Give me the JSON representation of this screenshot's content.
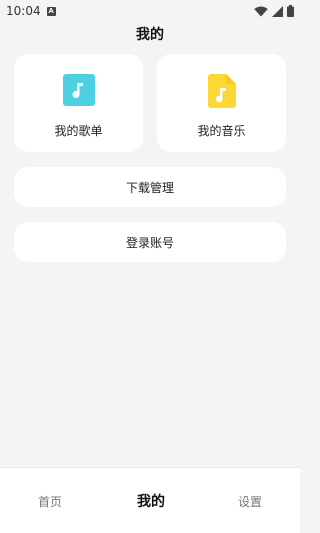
{
  "status_bar": {
    "time": "10:04",
    "notification_icon": "a-icon",
    "wifi_icon": "wifi-icon",
    "signal_icon": "signal-icon",
    "battery_icon": "battery-icon"
  },
  "header": {
    "title": "我的"
  },
  "cards": [
    {
      "label": "我的歌单",
      "icon": "music-note-icon",
      "color": "#4dd0e1"
    },
    {
      "label": "我的音乐",
      "icon": "music-file-icon",
      "color": "#fdd835"
    }
  ],
  "rows": {
    "download": "下载管理",
    "login": "登录账号"
  },
  "bottom_nav": {
    "home": "首页",
    "mine": "我的",
    "settings": "设置",
    "active": "我的"
  }
}
